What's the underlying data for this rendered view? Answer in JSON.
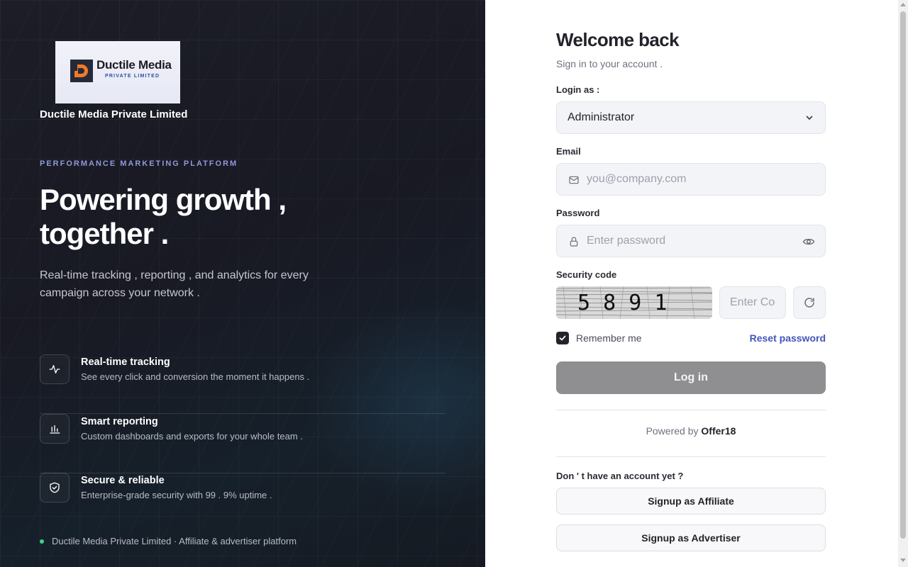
{
  "brand": {
    "logo_name": "Ductile Media",
    "logo_subtitle": "PRIVATE LIMITED",
    "company_name": "Ductile Media Private Limited"
  },
  "hero": {
    "eyebrow": "PERFORMANCE MARKETING PLATFORM",
    "headline_line1": "Powering growth ,",
    "headline_line2": "together .",
    "lead": "Real-time tracking , reporting , and analytics for every campaign across your network ."
  },
  "features": [
    {
      "title": "Real-time tracking",
      "description": "See every click and conversion the moment it happens .",
      "icon": "activity-icon"
    },
    {
      "title": "Smart reporting",
      "description": "Custom dashboards and exports for your whole team .",
      "icon": "bar-chart-icon"
    },
    {
      "title": "Secure & reliable",
      "description": "Enterprise-grade security with 99 . 9% uptime .",
      "icon": "shield-check-icon"
    }
  ],
  "footnote": "Ductile Media Private Limited · Affiliate & advertiser platform",
  "form": {
    "title": "Welcome back",
    "subtitle": "Sign in to your account .",
    "login_as_label": "Login as :",
    "login_as_value": "Administrator",
    "email_label": "Email",
    "email_placeholder": "you@company.com",
    "password_label": "Password",
    "password_placeholder": "Enter password",
    "security_label": "Security code",
    "captcha_text": "5 8 9 1",
    "code_placeholder": "Enter Code",
    "remember_label": "Remember me",
    "remember_checked": true,
    "reset_link": "Reset password",
    "login_button": "Log in",
    "powered_prefix": "Powered by",
    "powered_brand": "Offer18",
    "no_account": "Don ' t have an account yet ?",
    "signup_affiliate": "Signup as Affiliate",
    "signup_advertiser": "Signup as Advertiser"
  },
  "colors": {
    "left_bg": "#1a1b25",
    "accent_link": "#4355b9",
    "eyebrow": "#8e9ad8",
    "status_dot": "#3ed38a",
    "login_button_disabled": "#8f8f92"
  }
}
